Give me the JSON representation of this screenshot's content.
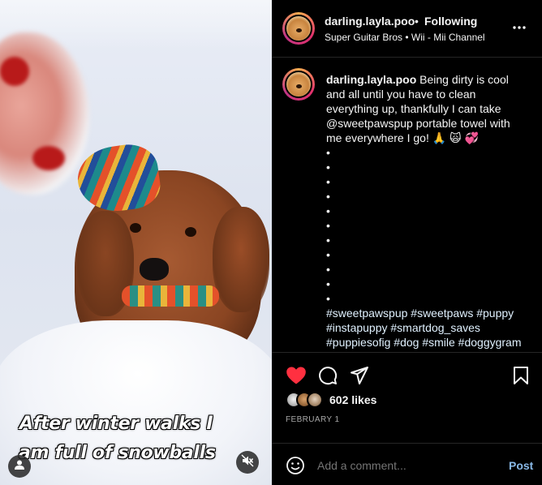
{
  "media": {
    "overlay_line1": "After winter walks I",
    "overlay_line2": "am full of snowballs"
  },
  "header": {
    "username": "darling.layla.poo",
    "separator": "•",
    "follow_status": "Following",
    "audio": "Super Guitar Bros • Wii - Mii Channel"
  },
  "caption": {
    "username": "darling.layla.poo",
    "text": "Being dirty is cool and all until you have to clean everything up, thankfully I can take @sweetpawspup portable towel with me everywhere I go! 🙏 🙀 💞",
    "bullets": [
      "•",
      "•",
      "•",
      "•",
      "•",
      "•",
      "•",
      "•",
      "•",
      "•",
      "•"
    ],
    "hashtags": "#sweetpawspup #sweetpaws #puppy #instapuppy #smartdog_saves #puppiesofig #dog #smile #doggygram #doglife #doggoofinstagram #dogsof"
  },
  "engagement": {
    "likes": "602 likes",
    "date": "FEBRUARY 1"
  },
  "comment_box": {
    "placeholder": "Add a comment...",
    "post_label": "Post"
  },
  "colors": {
    "like_red": "#ff3040",
    "post_blue": "#88b8e6",
    "background": "#000000"
  },
  "icons": {
    "like": "heart-icon",
    "comment": "comment-icon",
    "share": "share-icon",
    "save": "bookmark-icon",
    "more": "more-icon",
    "emoji": "emoji-icon",
    "tags": "user-tag-icon",
    "mute": "mute-icon"
  }
}
